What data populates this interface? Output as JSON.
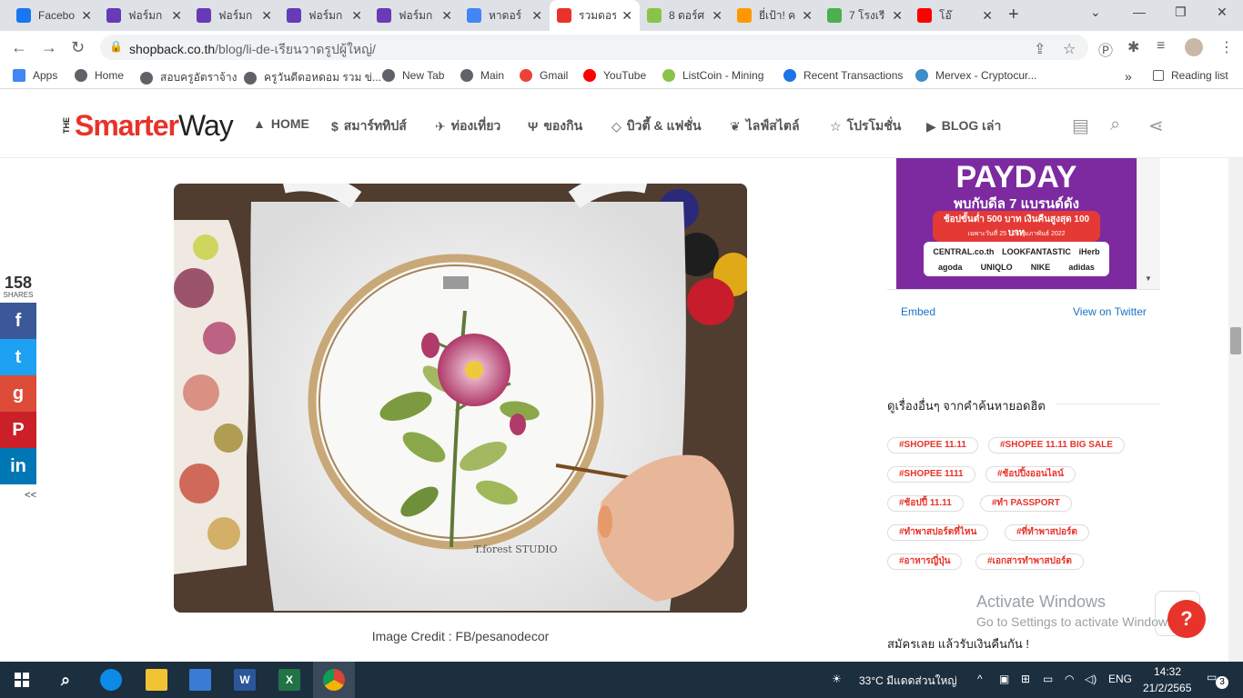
{
  "browser": {
    "tabs": [
      {
        "title": "Facebo",
        "icon": "facebook-icon",
        "color": "#1877f2",
        "active": false
      },
      {
        "title": "ฟอร์มก",
        "icon": "forms-icon",
        "color": "#673ab7",
        "active": false
      },
      {
        "title": "ฟอร์มก",
        "icon": "forms-icon",
        "color": "#673ab7",
        "active": false
      },
      {
        "title": "ฟอร์มก",
        "icon": "forms-icon",
        "color": "#673ab7",
        "active": false
      },
      {
        "title": "ฟอร์มก",
        "icon": "forms-icon",
        "color": "#673ab7",
        "active": false
      },
      {
        "title": "หาดอร์",
        "icon": "google-icon",
        "color": "#4285f4",
        "active": false
      },
      {
        "title": "รวมดอร",
        "icon": "shopback-icon",
        "color": "#e8332a",
        "active": true
      },
      {
        "title": "8 ดอร์ศ",
        "icon": "site-icon",
        "color": "#8bc34a",
        "active": false
      },
      {
        "title": "ยี่เป้า! ค",
        "icon": "site-icon",
        "color": "#ff9800",
        "active": false
      },
      {
        "title": "7 โรงเรี",
        "icon": "site-icon",
        "color": "#4caf50",
        "active": false
      },
      {
        "title": "โอ๊",
        "icon": "youtube-icon",
        "color": "#ff0000",
        "active": false
      }
    ],
    "url_host": "shopback.co.th",
    "url_path": "/blog/li-de-เรียนวาดรูปผู้ใหญ่/",
    "bookmarks": [
      {
        "label": "Apps",
        "icon": "apps-grid-icon"
      },
      {
        "label": "Home",
        "icon": "globe-icon"
      },
      {
        "label": "สอบครูอัตราจ้าง",
        "icon": "globe-icon"
      },
      {
        "label": "ครูวันดีดอหดอม รวม ข่...",
        "icon": "globe-icon"
      },
      {
        "label": "New Tab",
        "icon": "globe-icon"
      },
      {
        "label": "Main",
        "icon": "globe-icon"
      },
      {
        "label": "Gmail",
        "icon": "gmail-icon"
      },
      {
        "label": "YouTube",
        "icon": "youtube-icon"
      },
      {
        "label": "ListCoin - Mining",
        "icon": "listcoin-icon"
      },
      {
        "label": "Recent Transactions",
        "icon": "transactions-icon"
      },
      {
        "label": "Mervex - Cryptocur...",
        "icon": "mervex-icon"
      }
    ],
    "more_bookmarks": "»",
    "reading_list": "Reading list"
  },
  "site": {
    "logo_the": "THE",
    "logo_smarter": "Smarter",
    "logo_way": "Way",
    "menu": [
      {
        "label": "HOME",
        "icon": "home-icon"
      },
      {
        "label": "สมาร์ททิปส์",
        "icon": "dollar-icon"
      },
      {
        "label": "ท่องเที่ยว",
        "icon": "plane-icon"
      },
      {
        "label": "ของกิน",
        "icon": "fork-knife-icon"
      },
      {
        "label": "บิวตี้ & แฟชั่น",
        "icon": "diamond-icon"
      },
      {
        "label": "ไลฟ์สไตล์",
        "icon": "leaf-icon"
      },
      {
        "label": "โปรโมชั่น",
        "icon": "star-icon"
      },
      {
        "label": "BLOG เล่า",
        "icon": "youtube-play-icon"
      }
    ]
  },
  "article": {
    "image_credit": "Image Credit : FB/pesanodecor",
    "signature": "T.forest STUDIO"
  },
  "share": {
    "count": "158",
    "label": "SHARES",
    "buttons": [
      {
        "name": "facebook",
        "glyph": "f",
        "color": "#3b5998"
      },
      {
        "name": "twitter",
        "glyph": "t",
        "color": "#1da1f2"
      },
      {
        "name": "google-plus",
        "glyph": "g",
        "color": "#dd4b39"
      },
      {
        "name": "pinterest",
        "glyph": "P",
        "color": "#cb2027"
      },
      {
        "name": "linkedin",
        "glyph": "in",
        "color": "#0077b5"
      }
    ],
    "collapse": "<<"
  },
  "sidebar": {
    "ad": {
      "title": "PAYDAY",
      "subtitle": "พบกับดีล 7 แบรนด์ดัง",
      "promo": "ช้อปขั้นต่ำ 500 บาท เงินคืนสูงสุด 100 บาท",
      "date": "เฉพาะวันที่ 25 - 26 กุมภาพันธ์ 2022",
      "brands": [
        "CENTRAL.co.th",
        "LOOKFANTASTIC",
        "iHerb",
        "agoda",
        "UNIQLO",
        "NIKE",
        "adidas"
      ]
    },
    "embed": "Embed",
    "view_twitter": "View on Twitter",
    "tags_title": "ดูเรื่องอื่นๆ จากคำค้นหายอดฮิต",
    "tags": [
      "#SHOPEE 11.11",
      "#SHOPEE 11.11 BIG SALE",
      "#SHOPEE 1111",
      "#ช้อปปิ้งออนไลน์",
      "#ช้อปปี้ 11.11",
      "#ทำ PASSPORT",
      "#ทำพาสปอร์ตที่ไหน",
      "#ที่ทำพาสปอร์ต",
      "#อาหารญี่ปุ่น",
      "#เอกสารทำพาสปอร์ต"
    ],
    "subscribe": "สมัครเลย แล้วรับเงินคืนกัน !"
  },
  "watermark": {
    "line1": "Activate Windows",
    "line2": "Go to Settings to activate Windows."
  },
  "taskbar": {
    "weather": "33°C  มีแดดส่วนใหญ่",
    "lang": "ENG",
    "time": "14:32",
    "date": "21/2/2565",
    "notifications": "3"
  }
}
